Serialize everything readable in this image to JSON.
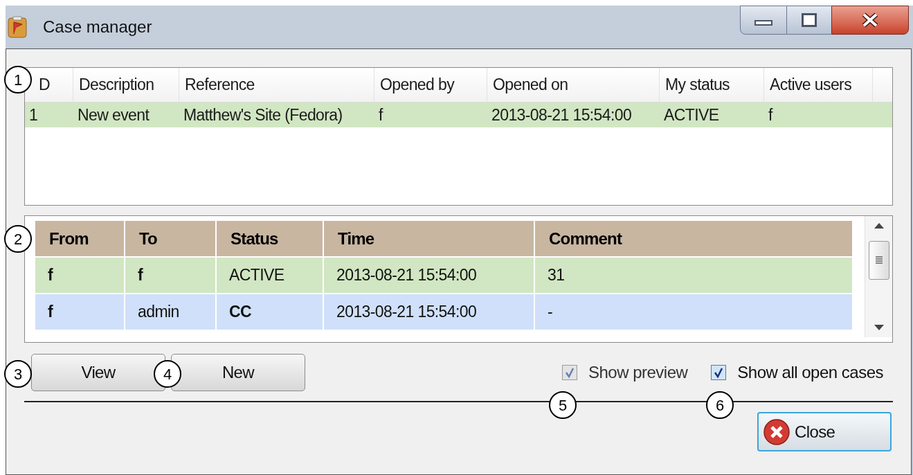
{
  "window": {
    "title": "Case manager"
  },
  "cases": {
    "columns": [
      "D",
      "Description",
      "Reference",
      "Opened by",
      "Opened on",
      "My status",
      "Active users"
    ],
    "rows": [
      {
        "selected": true,
        "cells": [
          "1",
          "New event",
          "Matthew's Site (Fedora)",
          "f",
          "2013-08-21 15:54:00",
          "ACTIVE",
          "f"
        ]
      }
    ]
  },
  "history": {
    "columns": [
      "From",
      "To",
      "Status",
      "Time",
      "Comment"
    ],
    "rows": [
      {
        "color": "#d1e6c2",
        "cells": [
          {
            "text": "f",
            "bold": true
          },
          {
            "text": "f",
            "bold": true
          },
          {
            "text": "ACTIVE",
            "bold": false
          },
          {
            "text": "2013-08-21 15:54:00",
            "bold": false
          },
          {
            "text": "31",
            "bold": false
          }
        ]
      },
      {
        "color": "#d0e0fa",
        "cells": [
          {
            "text": "f",
            "bold": true
          },
          {
            "text": "admin",
            "bold": false
          },
          {
            "text": "CC",
            "bold": true
          },
          {
            "text": "2013-08-21 15:54:00",
            "bold": false
          },
          {
            "text": "-",
            "bold": false
          }
        ]
      }
    ]
  },
  "buttons": [
    "View",
    "New"
  ],
  "checkboxes": [
    {
      "label": "Show preview",
      "checked": true,
      "disabled": true
    },
    {
      "label": "Show all open cases",
      "checked": true,
      "disabled": false
    }
  ],
  "close_button": "Close",
  "callouts": [
    "1",
    "2",
    "3",
    "4",
    "5",
    "6"
  ]
}
